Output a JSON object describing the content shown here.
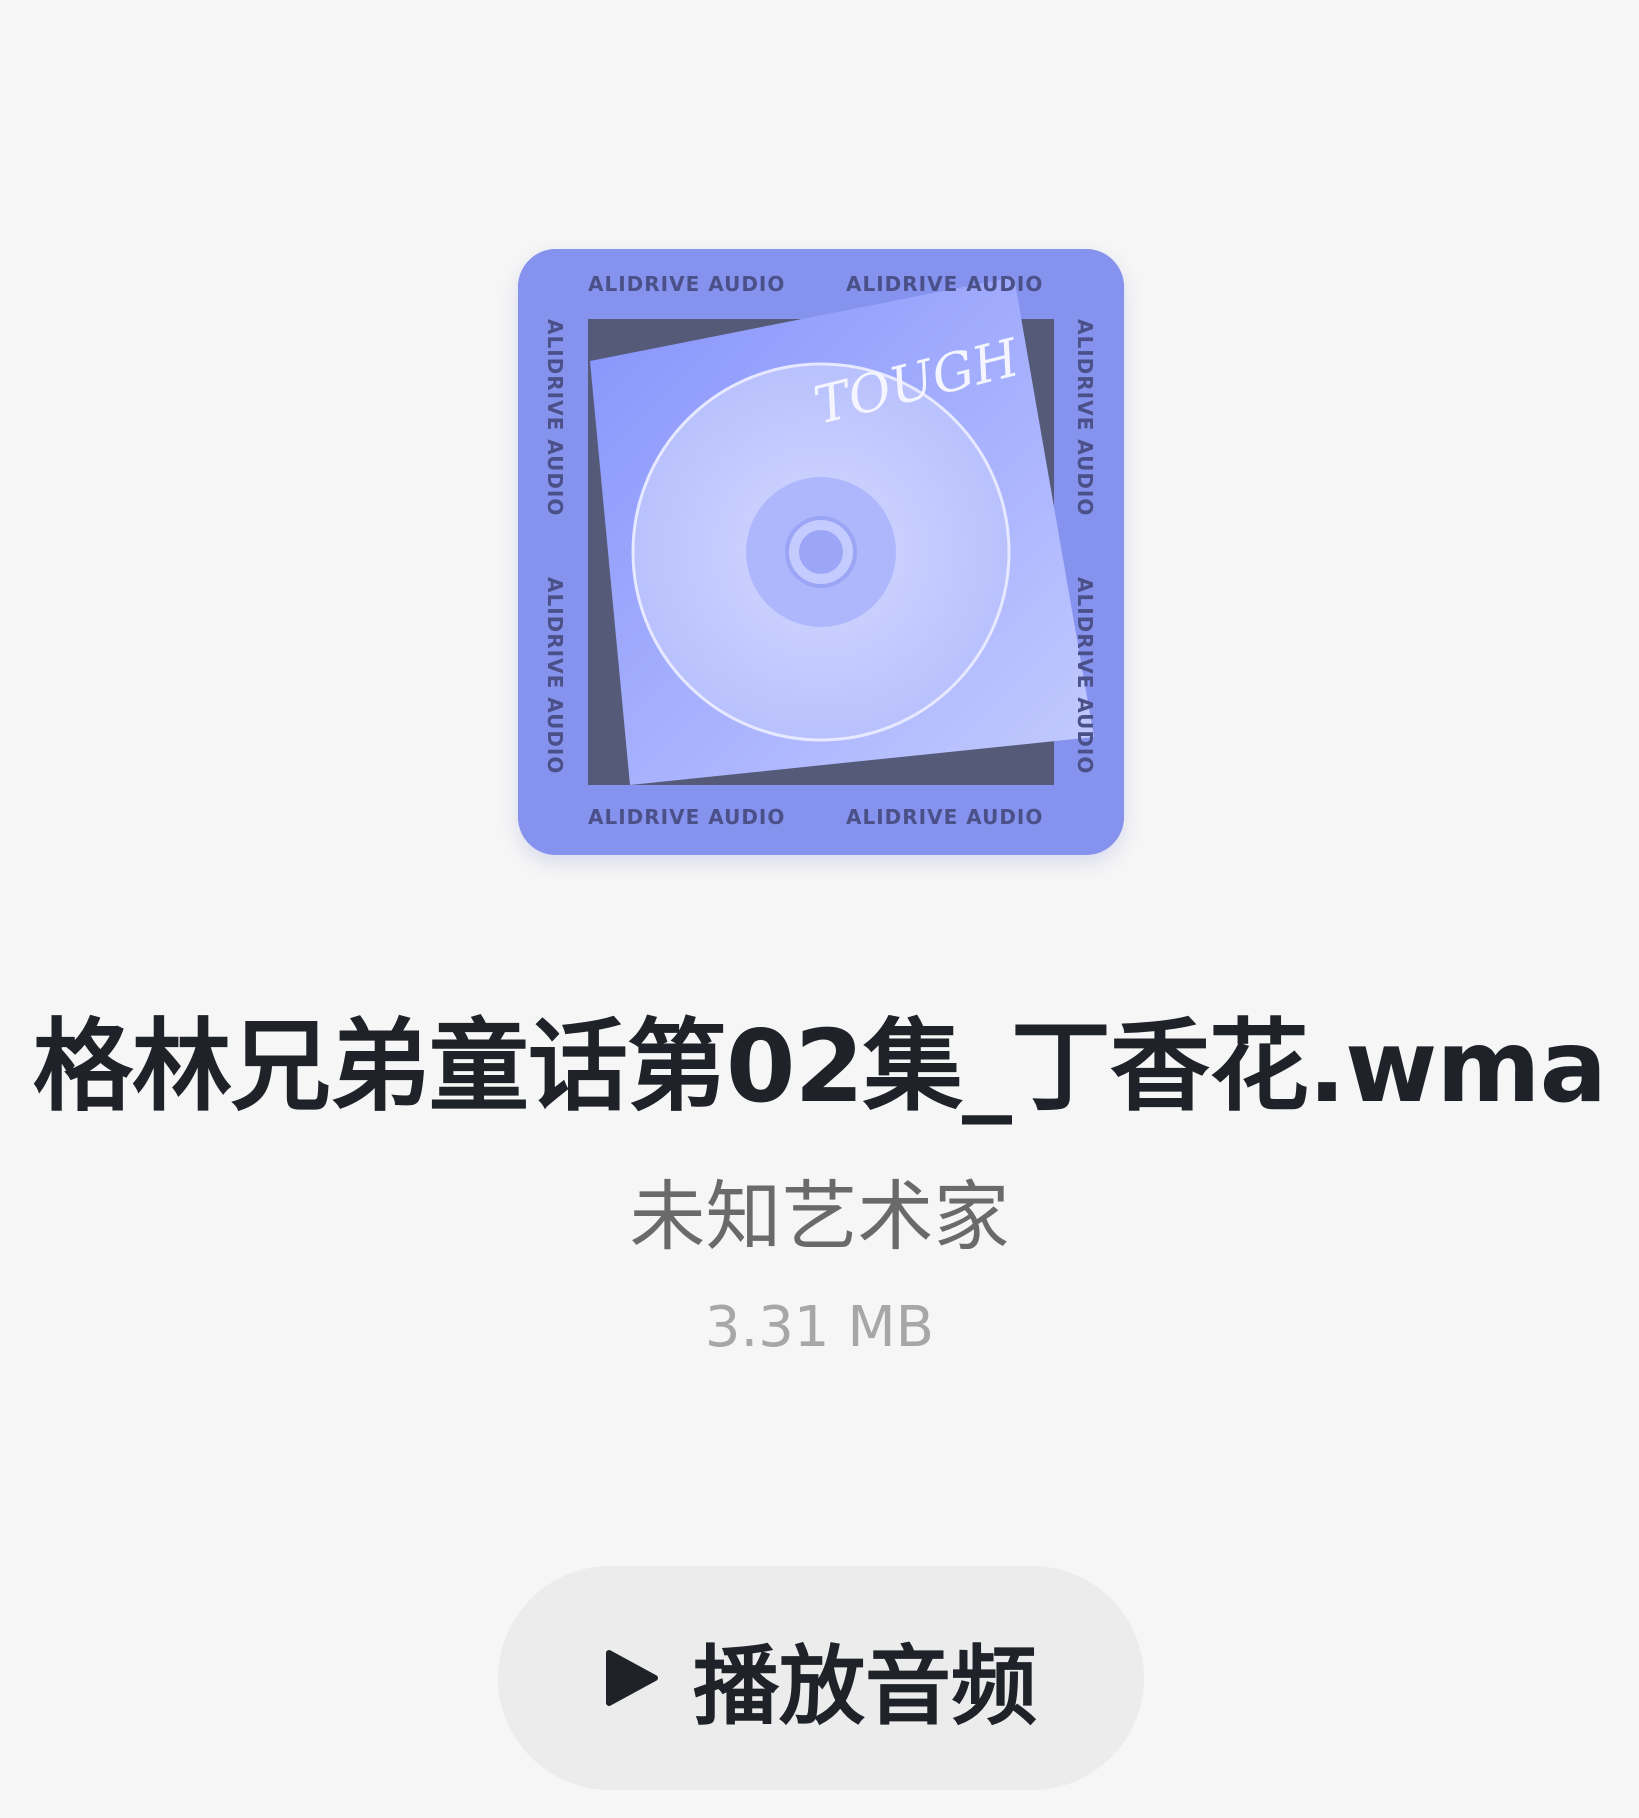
{
  "cover": {
    "icon": "album-cover-disc",
    "brand_text": "ALIDRIVE AUDIO",
    "script_text": "TOUGH",
    "colors": {
      "background": "#8c99f5",
      "frame": "#555a78",
      "sleeve": "#a5b0fb"
    }
  },
  "track": {
    "title": "格林兄弟童话第02集_丁香花.wma",
    "artist": "未知艺术家",
    "size": "3.31 MB"
  },
  "actions": {
    "play_icon": "play-icon",
    "play_label": "播放音频"
  }
}
